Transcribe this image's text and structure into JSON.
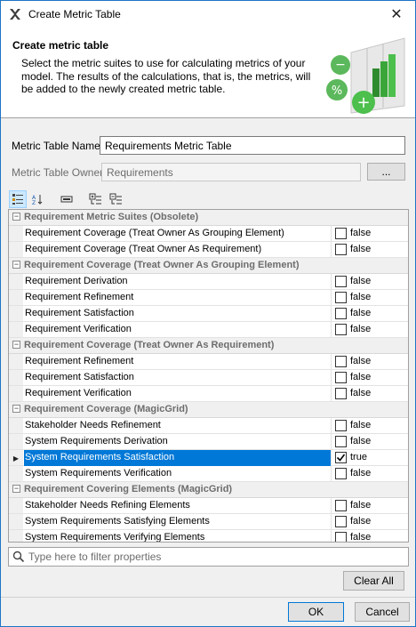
{
  "window": {
    "title": "Create Metric Table",
    "close_glyph": "✕"
  },
  "header": {
    "heading": "Create metric table",
    "description": "Select the metric suites to use for calculating metrics of your model. The results of the calculations, that is, the metrics, will be added to the newly created metric table."
  },
  "form": {
    "name_label": "Metric Table Name:",
    "name_value": "Requirements Metric Table",
    "owner_label": "Metric Table Owner:",
    "owner_value": "Requirements",
    "browse_label": "..."
  },
  "toolbar": {
    "icons": [
      "categorized-view-icon",
      "sort-alphabetically-icon",
      "compact-view-icon",
      "expand-all-icon",
      "collapse-all-icon"
    ]
  },
  "grid": {
    "groups": [
      {
        "name": "Requirement Metric Suites (Obsolete)",
        "toggle": "−",
        "rows": [
          {
            "name": "Requirement Coverage (Treat Owner As Grouping Element)",
            "value": "false",
            "checked": false
          },
          {
            "name": "Requirement Coverage (Treat Owner As Requirement)",
            "value": "false",
            "checked": false
          }
        ]
      },
      {
        "name": "Requirement Coverage (Treat Owner As Grouping Element)",
        "toggle": "−",
        "rows": [
          {
            "name": "Requirement Derivation",
            "value": "false",
            "checked": false
          },
          {
            "name": "Requirement Refinement",
            "value": "false",
            "checked": false
          },
          {
            "name": "Requirement Satisfaction",
            "value": "false",
            "checked": false
          },
          {
            "name": "Requirement Verification",
            "value": "false",
            "checked": false
          }
        ]
      },
      {
        "name": "Requirement Coverage (Treat Owner As Requirement)",
        "toggle": "−",
        "rows": [
          {
            "name": "Requirement Refinement",
            "value": "false",
            "checked": false
          },
          {
            "name": "Requirement Satisfaction",
            "value": "false",
            "checked": false
          },
          {
            "name": "Requirement Verification",
            "value": "false",
            "checked": false
          }
        ]
      },
      {
        "name": "Requirement Coverage (MagicGrid)",
        "toggle": "−",
        "rows": [
          {
            "name": "Stakeholder Needs Refinement",
            "value": "false",
            "checked": false
          },
          {
            "name": "System Requirements Derivation",
            "value": "false",
            "checked": false
          },
          {
            "name": "System Requirements Satisfaction",
            "value": "true",
            "checked": true,
            "selected": true,
            "arrow": "▶"
          },
          {
            "name": "System Requirements Verification",
            "value": "false",
            "checked": false
          }
        ]
      },
      {
        "name": "Requirement Covering Elements (MagicGrid)",
        "toggle": "−",
        "rows": [
          {
            "name": "Stakeholder Needs Refining Elements",
            "value": "false",
            "checked": false
          },
          {
            "name": "System Requirements Satisfying Elements",
            "value": "false",
            "checked": false
          },
          {
            "name": "System Requirements Verifying Elements",
            "value": "false",
            "checked": false
          }
        ]
      }
    ]
  },
  "filter": {
    "placeholder": "Type here to filter properties"
  },
  "buttons": {
    "clear_all": "Clear All",
    "ok": "OK",
    "cancel": "Cancel"
  },
  "colors": {
    "selection": "#0078d7",
    "accent_border": "#1c74c6"
  }
}
